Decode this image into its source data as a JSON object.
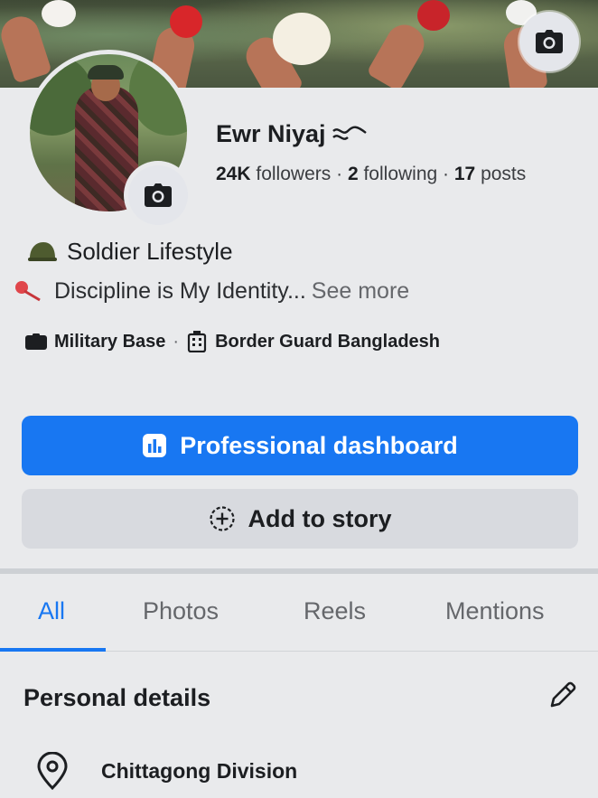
{
  "profile": {
    "name": "Ewr Niyaj",
    "followers_count": "24K",
    "followers_label": "followers",
    "following_count": "2",
    "following_label": "following",
    "posts_count": "17",
    "posts_label": "posts",
    "separator": "·"
  },
  "bio": {
    "line1": "Soldier Lifestyle",
    "line2": "Discipline is My Identity...",
    "see_more": "See more"
  },
  "intro": {
    "item1": "Military Base",
    "item2": "Border Guard Bangladesh",
    "separator": "·"
  },
  "buttons": {
    "professional_dashboard": "Professional dashboard",
    "add_to_story": "Add to story"
  },
  "tabs": [
    {
      "label": "All",
      "active": true
    },
    {
      "label": "Photos",
      "active": false
    },
    {
      "label": "Reels",
      "active": false
    },
    {
      "label": "Mentions",
      "active": false
    }
  ],
  "personal_details": {
    "title": "Personal details",
    "location": "Chittagong Division"
  },
  "colors": {
    "accent": "#1877f2",
    "secondary_button": "#d8dadf",
    "background": "#e9eaec",
    "muted_text": "#65676b"
  },
  "icons": [
    "camera-icon",
    "helmet-emoji-icon",
    "pushpin-emoji-icon",
    "briefcase-icon",
    "building-icon",
    "dashboard-icon",
    "add-circle-icon",
    "pencil-icon",
    "location-pin-icon",
    "wave-emoji-icon"
  ]
}
